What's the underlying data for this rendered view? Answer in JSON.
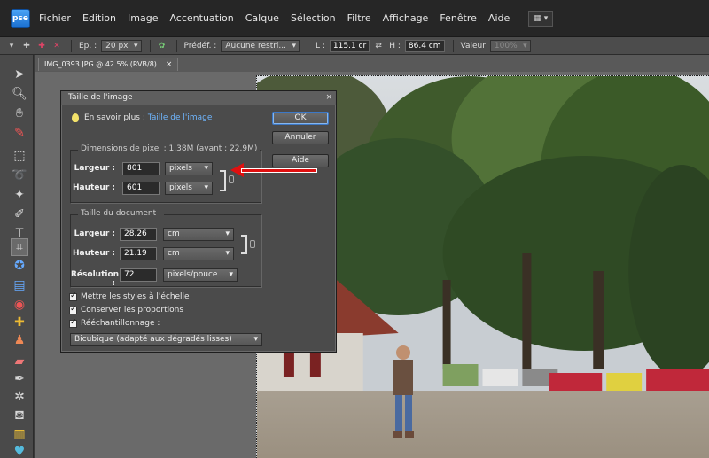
{
  "menubar": {
    "logo": "pse",
    "items": [
      "Fichier",
      "Edition",
      "Image",
      "Accentuation",
      "Calque",
      "Sélection",
      "Filtre",
      "Affichage",
      "Fenêtre",
      "Aide"
    ]
  },
  "options": {
    "brush_size_label": "Ep. :",
    "brush_size_value": "20 px",
    "preset_label": "Prédéf. :",
    "preset_value": "Aucune restri...",
    "width_label": "L :",
    "width_value": "115.1 cr",
    "height_label": "H :",
    "height_value": "86.4 cm",
    "value_label": "Valeur",
    "value_value": "100%"
  },
  "document": {
    "tab_title": "IMG_0393.JPG @ 42.5% (RVB/8)",
    "close": "×"
  },
  "dialog": {
    "title": "Taille de l'image",
    "close": "×",
    "learn_prefix": "En savoir plus :",
    "learn_link": "Taille de l'image",
    "ok": "OK",
    "cancel": "Annuler",
    "help": "Aide",
    "pixel_dims": {
      "title": "Dimensions de pixel : 1.38M (avant : 22.9M)",
      "width_label": "Largeur :",
      "width_value": "801",
      "width_unit": "pixels",
      "height_label": "Hauteur :",
      "height_value": "601",
      "height_unit": "pixels"
    },
    "doc_size": {
      "title": "Taille du document :",
      "width_label": "Largeur :",
      "width_value": "28.26",
      "width_unit": "cm",
      "height_label": "Hauteur :",
      "height_value": "21.19",
      "height_unit": "cm",
      "res_label": "Résolution :",
      "res_value": "72",
      "res_unit": "pixels/pouce"
    },
    "scale_styles": "Mettre les styles à l'échelle",
    "constrain": "Conserver les proportions",
    "resample": "Rééchantillonnage :",
    "resample_method": "Bicubique (adapté aux dégradés lisses)"
  },
  "colors": {
    "link": "#6fb6ff",
    "annotation": "#e01010"
  }
}
